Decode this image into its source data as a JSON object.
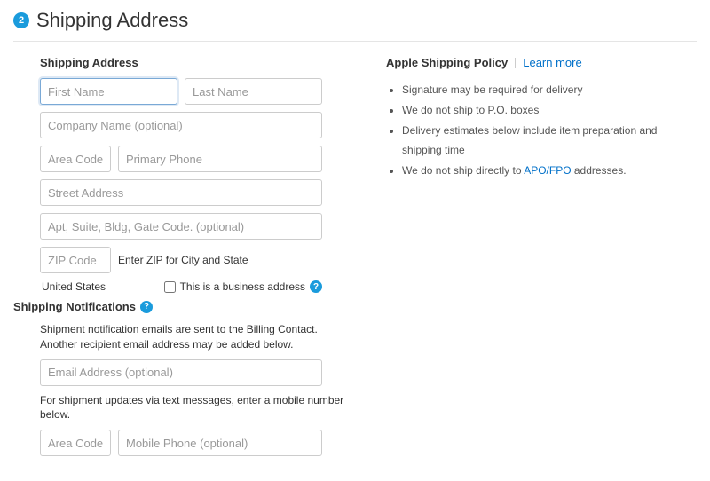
{
  "header": {
    "step_number": "2",
    "title": "Shipping Address"
  },
  "form": {
    "section_title": "Shipping Address",
    "first_name": {
      "placeholder": "First Name",
      "value": ""
    },
    "last_name": {
      "placeholder": "Last Name",
      "value": ""
    },
    "company": {
      "placeholder": "Company Name (optional)",
      "value": ""
    },
    "area_code": {
      "placeholder": "Area Code",
      "value": ""
    },
    "primary_phone": {
      "placeholder": "Primary Phone",
      "value": ""
    },
    "street": {
      "placeholder": "Street Address",
      "value": ""
    },
    "apt": {
      "placeholder": "Apt, Suite, Bldg, Gate Code. (optional)",
      "value": ""
    },
    "zip": {
      "placeholder": "ZIP Code",
      "value": ""
    },
    "zip_hint": "Enter ZIP for City and State",
    "country": "United States",
    "business_label": "This is a business address"
  },
  "notifications": {
    "title": "Shipping Notifications",
    "email_desc": "Shipment notification emails are sent to the Billing Contact. Another recipient email address may be added below.",
    "email": {
      "placeholder": "Email Address (optional)",
      "value": ""
    },
    "sms_desc": "For shipment updates via text messages, enter a mobile number below.",
    "sms_area": {
      "placeholder": "Area Code",
      "value": ""
    },
    "sms_phone": {
      "placeholder": "Mobile Phone (optional)",
      "value": ""
    }
  },
  "policy": {
    "title": "Apple Shipping Policy",
    "learn_more": "Learn more",
    "bullets": [
      "Signature may be required for delivery",
      "We do not ship to P.O. boxes",
      "Delivery estimates below include item preparation and shipping time"
    ],
    "last_prefix": "We do not ship directly to ",
    "last_link": "APO/FPO",
    "last_suffix": " addresses."
  },
  "help_glyph": "?"
}
